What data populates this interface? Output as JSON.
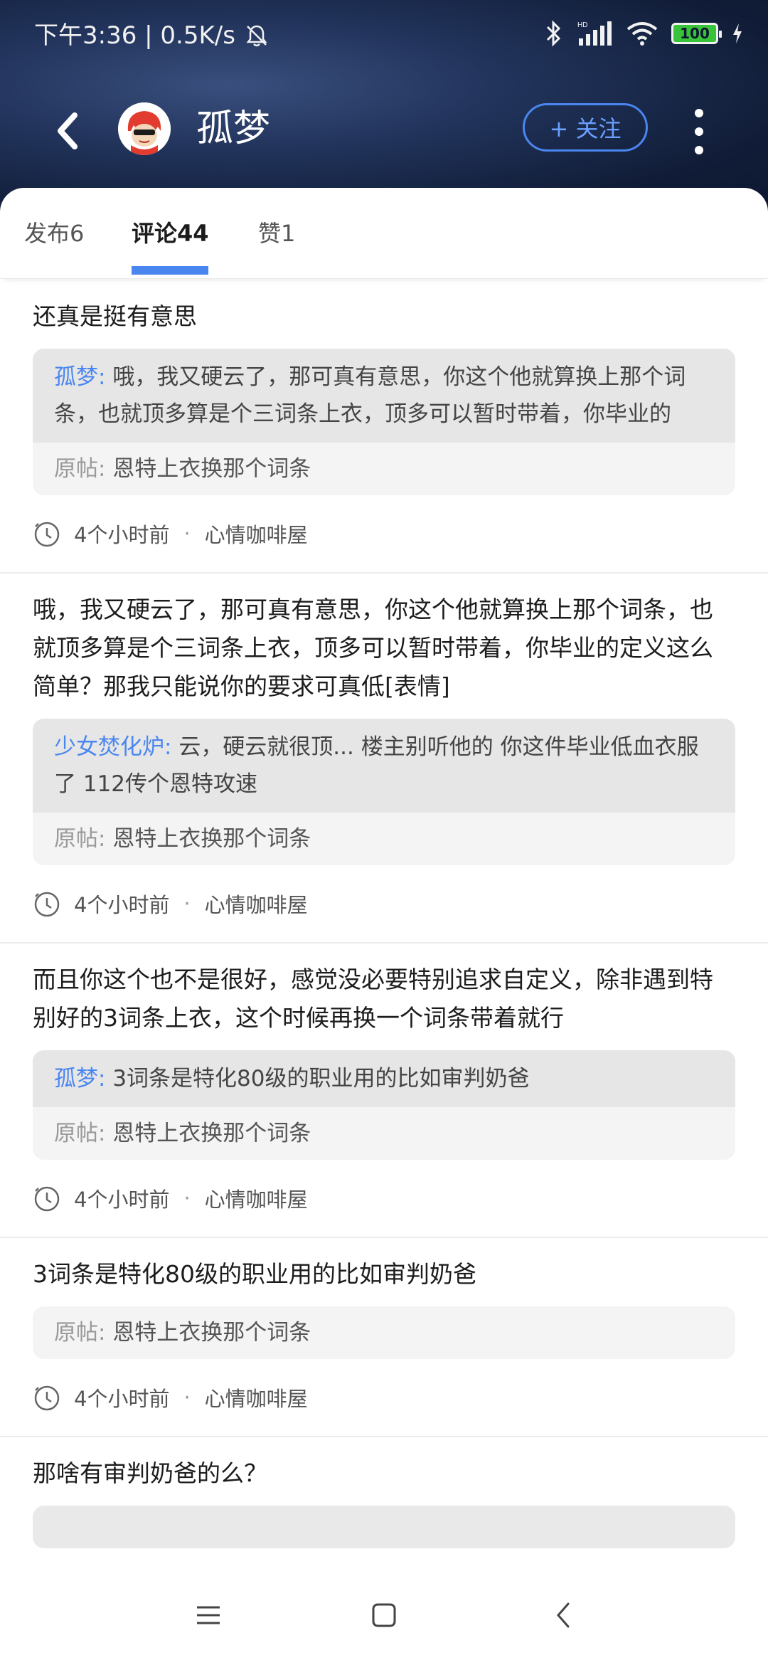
{
  "status_bar": {
    "time_and_speed": "下午3:36 | 0.5K/s",
    "battery": "100"
  },
  "header": {
    "user_name": "孤梦",
    "follow_label": "+ 关注"
  },
  "tabs": [
    {
      "label": "发布6",
      "active": false
    },
    {
      "label": "评论44",
      "active": true
    },
    {
      "label": "赞1",
      "active": false
    }
  ],
  "items": [
    {
      "text": "还真是挺有意思",
      "reply_author": "孤梦:",
      "reply_text": "哦，我又硬云了，那可真有意思，你这个他就算换上那个词条，也就顶多算是个三词条上衣，顶多可以暂时带着，你毕业的",
      "original_label": "原帖:",
      "original_text": "恩特上衣换那个词条",
      "time": "4个小时前",
      "dot": "·",
      "circle": "心情咖啡屋"
    },
    {
      "text": "哦，我又硬云了，那可真有意思，你这个他就算换上那个词条，也就顶多算是个三词条上衣，顶多可以暂时带着，你毕业的定义这么简单？那我只能说你的要求可真低[表情]",
      "reply_author": "少女焚化炉:",
      "reply_text": "云，硬云就很顶... 楼主别听他的 你这件毕业低血衣服了 112传个恩特攻速",
      "original_label": "原帖:",
      "original_text": "恩特上衣换那个词条",
      "time": "4个小时前",
      "dot": "·",
      "circle": "心情咖啡屋"
    },
    {
      "text": "而且你这个也不是很好，感觉没必要特别追求自定义，除非遇到特别好的3词条上衣，这个时候再换一个词条带着就行",
      "reply_author": "孤梦:",
      "reply_text": "3词条是特化80级的职业用的比如审判奶爸",
      "original_label": "原帖:",
      "original_text": "恩特上衣换那个词条",
      "time": "4个小时前",
      "dot": "·",
      "circle": "心情咖啡屋"
    },
    {
      "text": "3词条是特化80级的职业用的比如审判奶爸",
      "original_label": "原帖:",
      "original_text": "恩特上衣换那个词条",
      "time": "4个小时前",
      "dot": "·",
      "circle": "心情咖啡屋"
    },
    {
      "text": "那啥有审判奶爸的么？"
    }
  ],
  "colors": {
    "accent": "#4a86f0",
    "header_bg": "#1a2a4e"
  }
}
